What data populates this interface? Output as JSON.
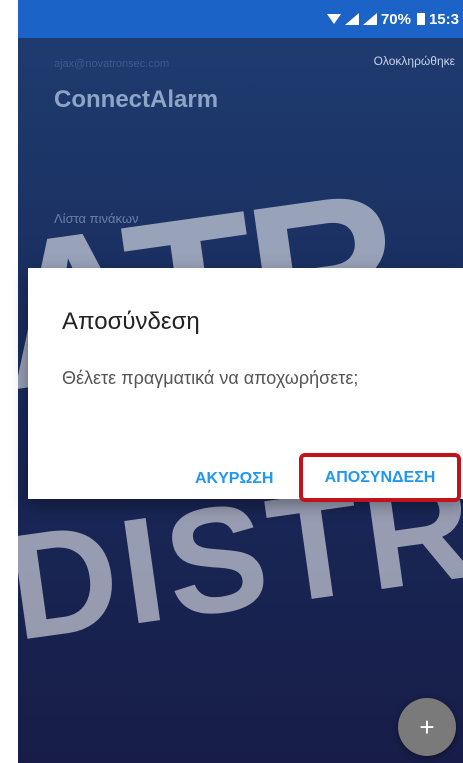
{
  "status_bar": {
    "battery": "70%",
    "time": "15:3"
  },
  "app": {
    "account_email": "ajax@novatronsec.com",
    "done_label": "Ολοκληρώθηκε",
    "title": "ConnectAlarm",
    "panels_list_label": "Λίστα πινάκων",
    "fab_label": "+"
  },
  "watermark": {
    "line1": "ATR",
    "line2": "DISTR"
  },
  "dialog": {
    "title": "Αποσύνδεση",
    "message": "Θέλετε πραγματικά να αποχωρήσετε;",
    "cancel_label": "ΑΚΥΡΩΣΗ",
    "logout_label": "ΑΠΟΣΥΝΔΕΣΗ"
  },
  "colors": {
    "status_bar": "#1c63c8",
    "app_bg_top": "#1e3b6f",
    "app_bg_bottom": "#171d48",
    "accent": "#2196f3",
    "highlight": "#c4121d"
  }
}
